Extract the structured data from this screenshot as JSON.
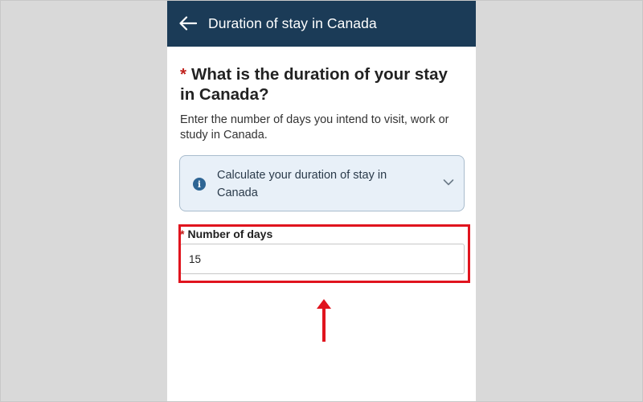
{
  "appbar": {
    "title": "Duration of stay in Canada",
    "back_icon": "arrow-left-icon"
  },
  "question": {
    "required_marker": "*",
    "text": "What is the duration of your stay in Canada?"
  },
  "help_text": "Enter the number of days you intend to visit, work or study in Canada.",
  "info_card": {
    "icon": "info-icon",
    "label": "Calculate your duration of stay in Canada",
    "toggle_icon": "chevron-down-icon"
  },
  "days_field": {
    "required_marker": "*",
    "label": "Number of days",
    "value": "15"
  },
  "colors": {
    "appbar": "#1b3b57",
    "required": "#c0211c",
    "info_card_bg": "#e8f0f8",
    "annotation": "#e0141e"
  }
}
